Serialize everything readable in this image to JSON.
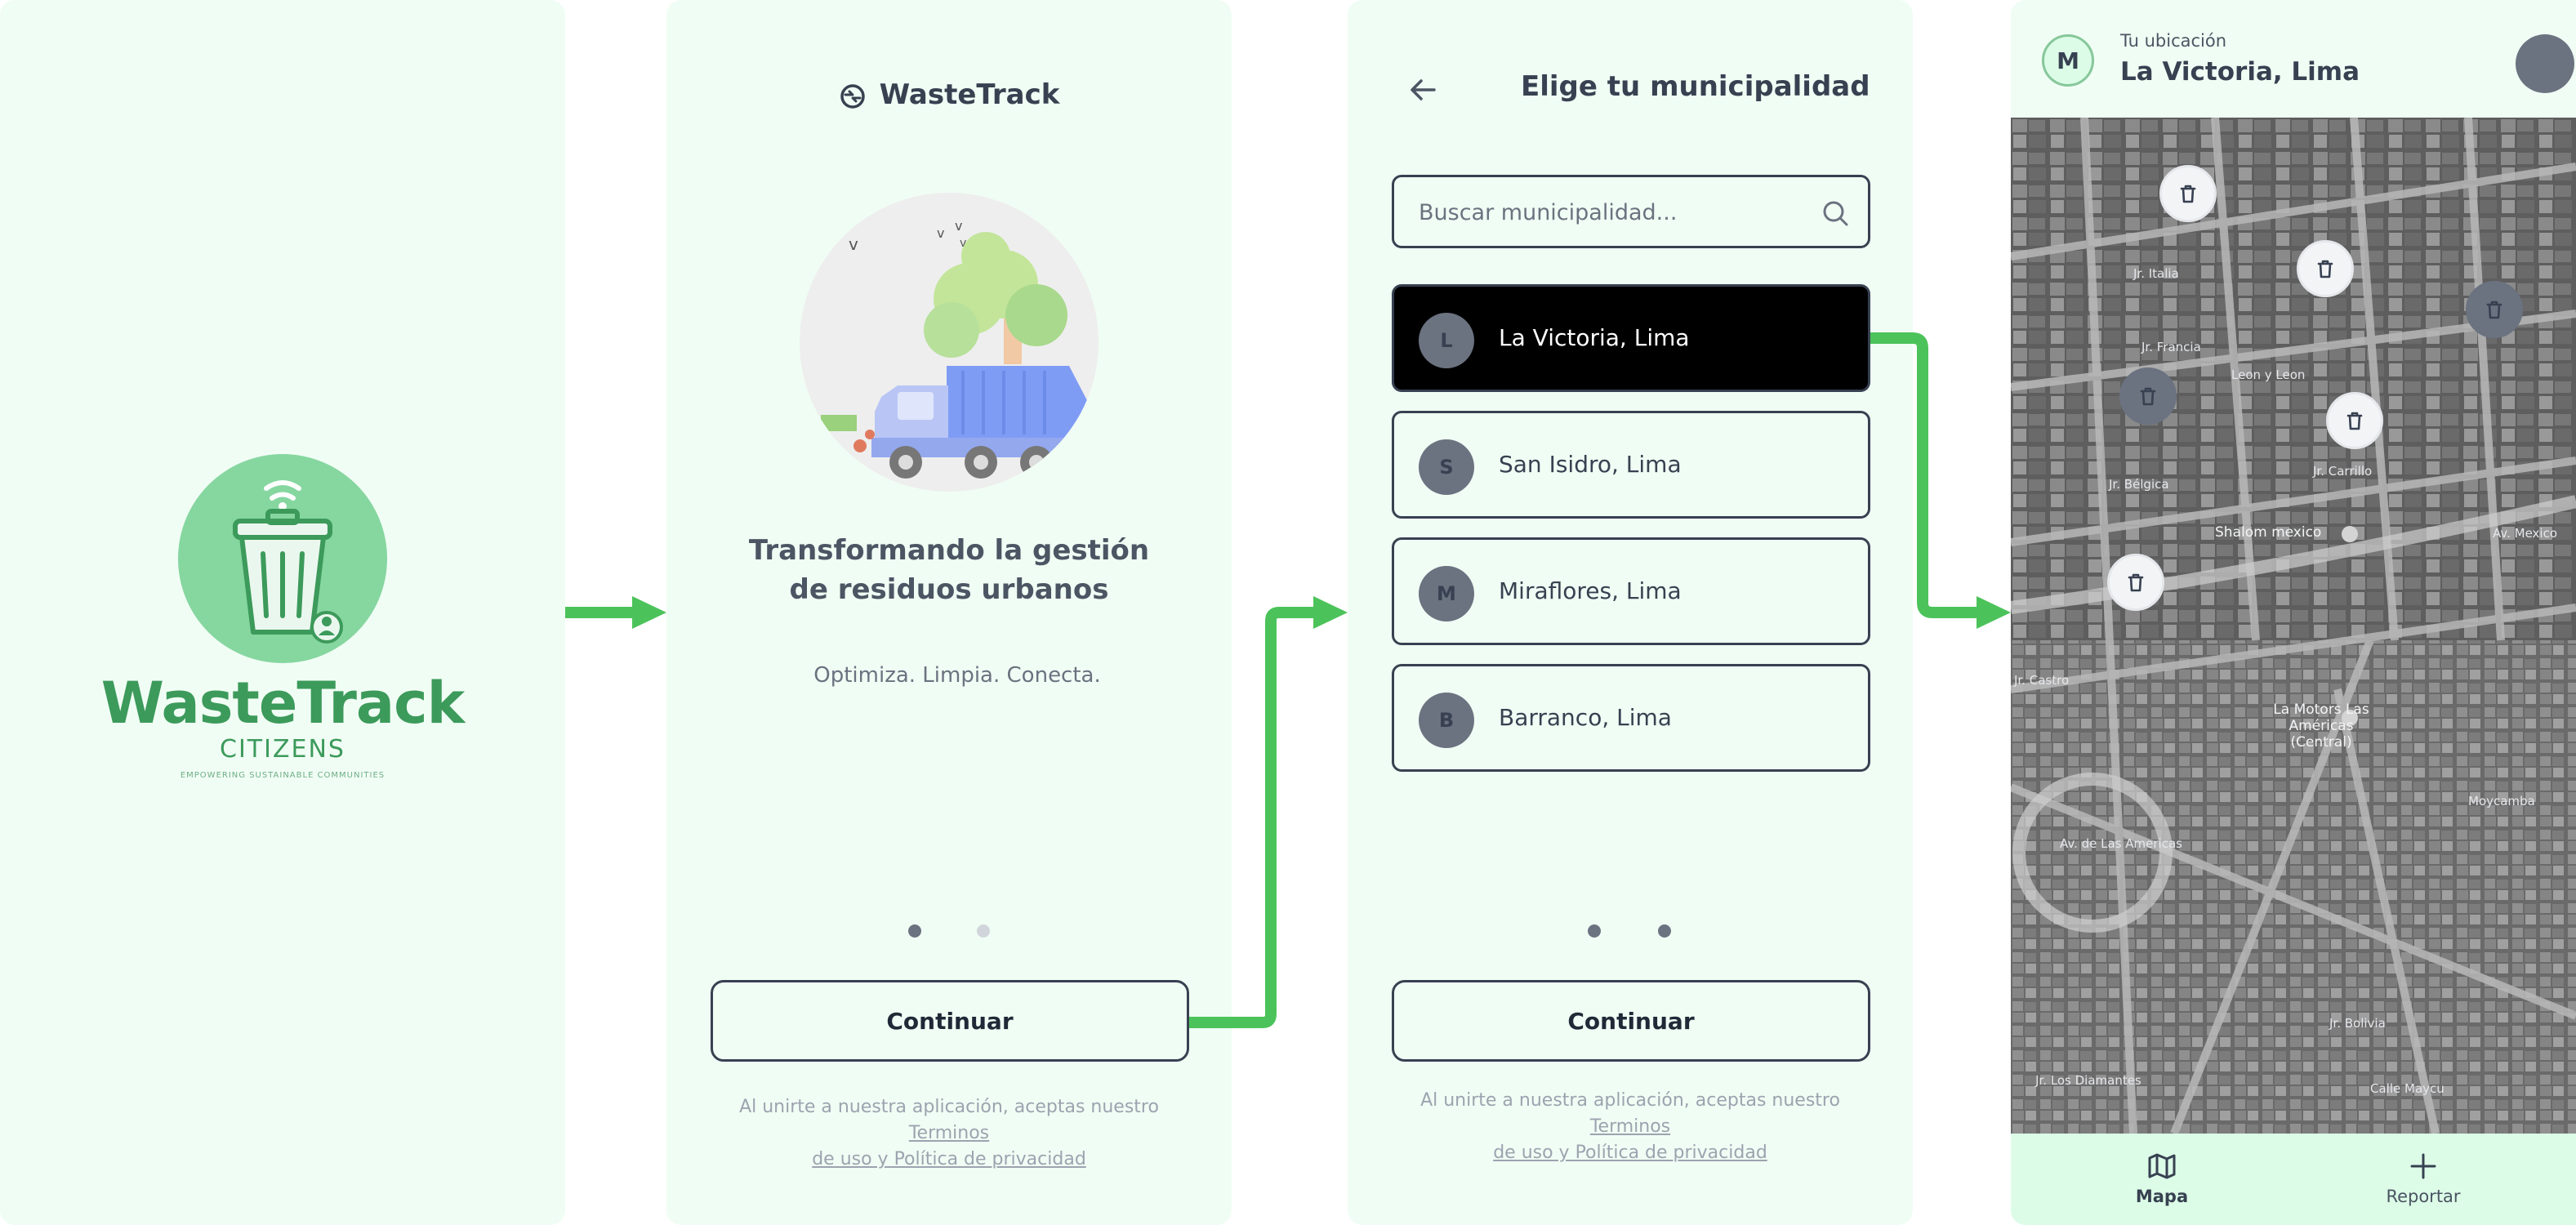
{
  "splash": {
    "logo_word": "WasteTrack",
    "logo_sub": "CITIZENS",
    "logo_tagline": "EMPOWERING SUSTAINABLE COMMUNITIES"
  },
  "onboarding": {
    "brand": "WasteTrack",
    "title_line1": "Transformando la gestión",
    "title_line2": "de residuos urbanos",
    "subtitle": "Optimiza. Limpia. Conecta.",
    "continue_label": "Continuar",
    "legal_prefix": "Al unirte a nuestra aplicación, aceptas nuestro",
    "legal_link_1": "Terminos",
    "legal_link_2": "de uso y Política de privacidad"
  },
  "municipality": {
    "title": "Elige tu municipalidad",
    "search_placeholder": "Buscar municipalidad...",
    "items": [
      {
        "initial": "L",
        "name": "La Victoria, Lima",
        "selected": true
      },
      {
        "initial": "S",
        "name": "San Isidro, Lima",
        "selected": false
      },
      {
        "initial": "M",
        "name": "Miraflores, Lima",
        "selected": false
      },
      {
        "initial": "B",
        "name": "Barranco, Lima",
        "selected": false
      }
    ],
    "continue_label": "Continuar",
    "legal_line1": "Al unirte a nuestra aplicación, aceptas nuestro",
    "legal_link_1": "Terminos",
    "legal_link_2": "de uso y Política de privacidad"
  },
  "map_screen": {
    "avatar_initial": "M",
    "location_label": "Tu ubicación",
    "location_value": "La Victoria, Lima",
    "poi_1": "Shalom mexico",
    "poi_2": "La Motors Las Américas (Central)",
    "streets": [
      "Jr. Italia",
      "Jr. Francia",
      "Leon y Leon",
      "Jr. Carrillo",
      "Jr. Bélgica",
      "Av. Mexico",
      "Av. de Las Americas",
      "Jr. Castro",
      "Moycamba",
      "Jr. Los Diamantes",
      "Jr. Bolivia",
      "Calle Maycu"
    ],
    "nav": [
      {
        "label": "Mapa",
        "icon": "map-icon",
        "active": true
      },
      {
        "label": "Reportar",
        "icon": "plus-icon",
        "active": false
      }
    ]
  },
  "colors": {
    "screen_bg": "#f0fdf4",
    "accent_green": "#4cc35a",
    "logo_green": "#3c9a5b",
    "dark": "#374151",
    "selected_bg": "#000000"
  }
}
